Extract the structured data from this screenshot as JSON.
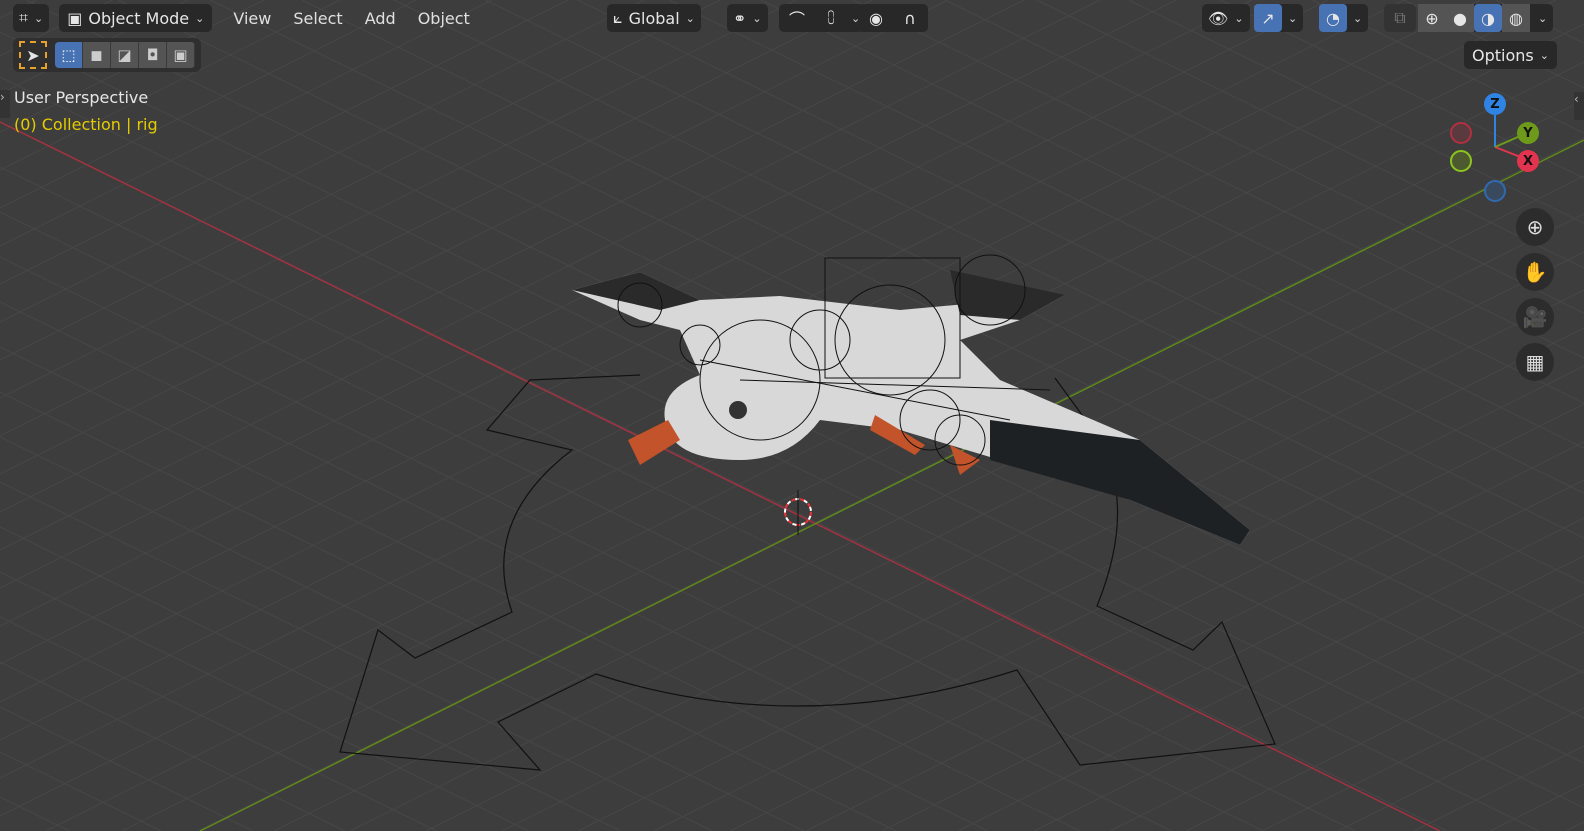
{
  "header": {
    "editor_type_icon": "3d-viewport-icon",
    "mode": "Object Mode",
    "menus": [
      "View",
      "Select",
      "Add",
      "Object"
    ],
    "transform_orientation": "Global",
    "options_label": "Options"
  },
  "overlay": {
    "view_name": "User Perspective",
    "collection_info": "(0) Collection | rig"
  },
  "gizmo": {
    "z": "Z",
    "y": "Y",
    "x": "X"
  },
  "colors": {
    "accent": "#4772b3",
    "x_axis": "#e3344f",
    "y_axis": "#6e9a1c",
    "z_axis": "#2f83e3",
    "info_text": "#e5cc00"
  }
}
